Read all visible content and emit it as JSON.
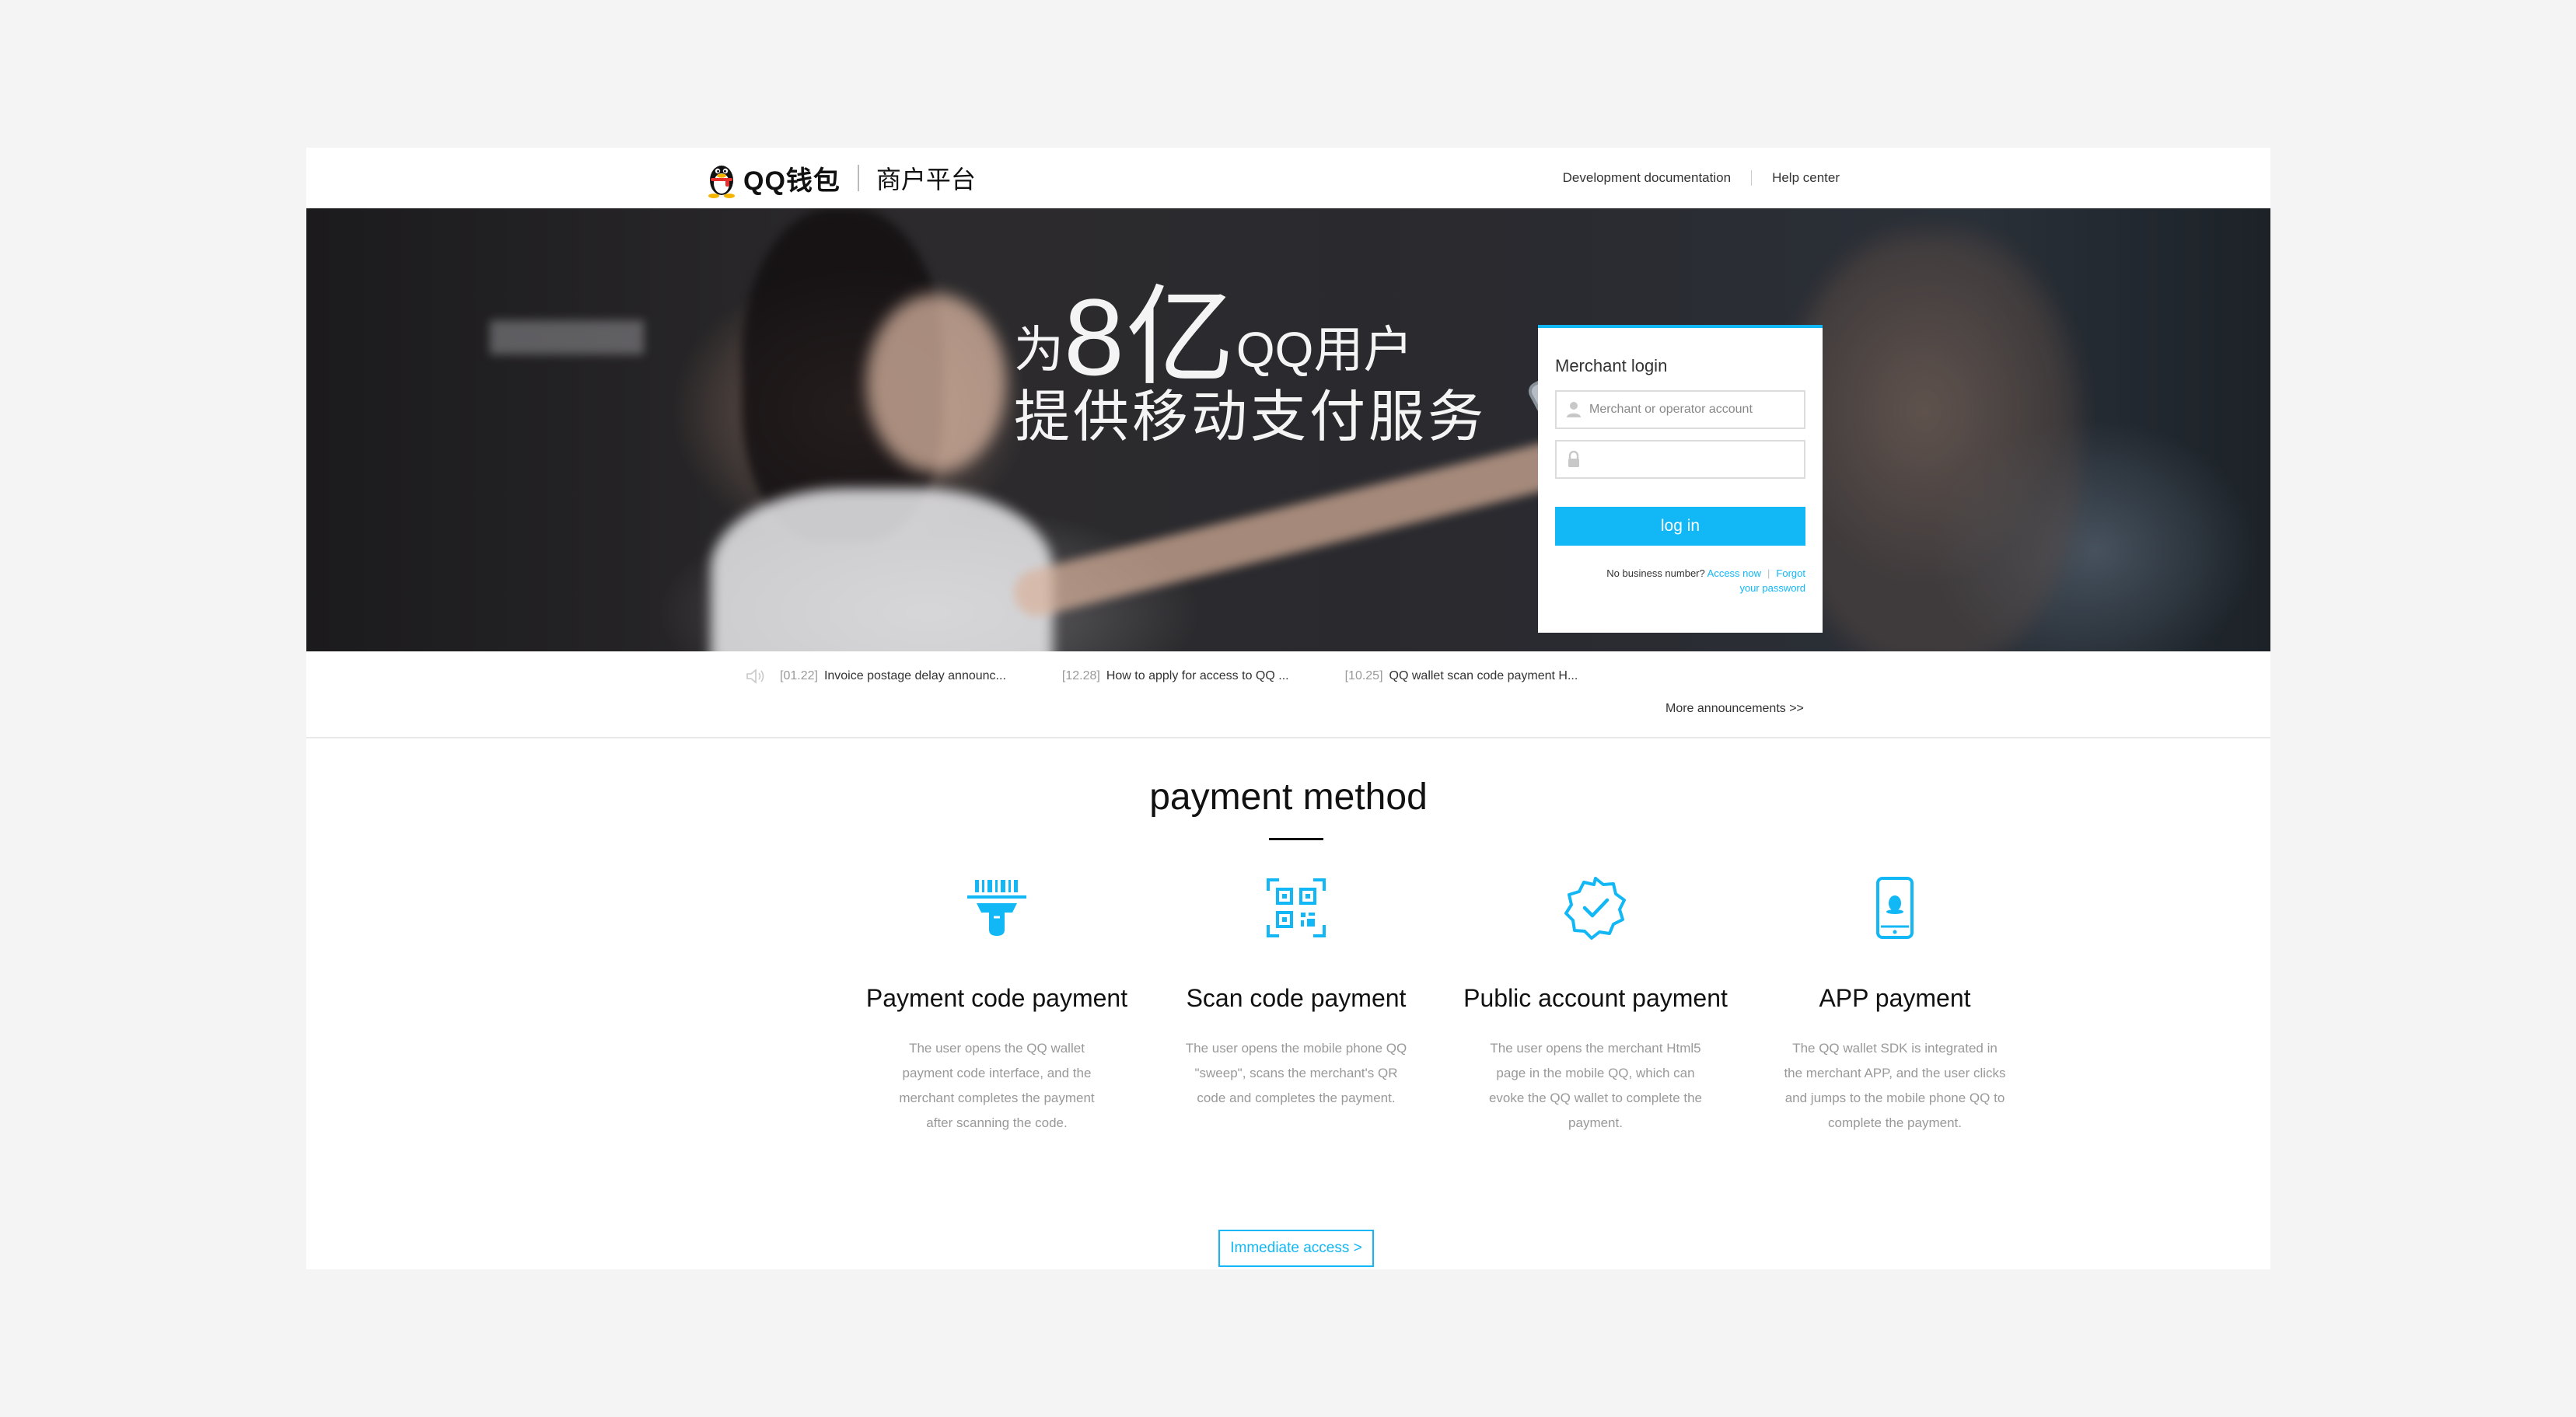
{
  "header": {
    "brand": "QQ钱包",
    "platform": "商户平台",
    "nav": [
      "Development documentation",
      "Help center"
    ]
  },
  "hero": {
    "slogan_prefix": "为",
    "slogan_big": "8亿",
    "slogan_suffix": "QQ用户",
    "slogan_line2": "提供移动支付服务"
  },
  "login": {
    "title": "Merchant login",
    "account_placeholder": "Merchant or operator account",
    "password_placeholder": "",
    "button": "log in",
    "no_business": "No business number?",
    "access_now": "Access now",
    "forgot_line1": "Forgot",
    "forgot_line2": "your password"
  },
  "announcements": {
    "items": [
      {
        "date": "[01.22]",
        "text": "Invoice postage delay announc..."
      },
      {
        "date": "[12.28]",
        "text": "How to apply for access to QQ ..."
      },
      {
        "date": "[10.25]",
        "text": "QQ wallet scan code payment H..."
      }
    ],
    "more": "More announcements >>"
  },
  "payment": {
    "title": "payment method",
    "methods": [
      {
        "name": "Payment code payment",
        "icon": "barcode-scanner-icon",
        "desc": "The user opens the QQ wallet payment code interface, and the merchant completes the payment after scanning the code."
      },
      {
        "name": "Scan code payment",
        "icon": "qr-code-icon",
        "desc": "The user opens the mobile phone QQ \"sweep\", scans the merchant's QR code and completes the payment."
      },
      {
        "name": "Public account payment",
        "icon": "verified-badge-icon",
        "desc": "The user opens the merchant Html5 page in the mobile QQ, which can evoke the QQ wallet to complete the payment."
      },
      {
        "name": "APP payment",
        "icon": "mobile-app-icon",
        "desc": "The QQ wallet SDK is integrated in the merchant APP, and the user clicks and jumps to the mobile phone QQ to complete the payment."
      }
    ],
    "cta": "Immediate access >"
  },
  "colors": {
    "accent": "#12b7f5",
    "background": "#f4f4f4",
    "text": "#333333",
    "muted": "#999999"
  }
}
